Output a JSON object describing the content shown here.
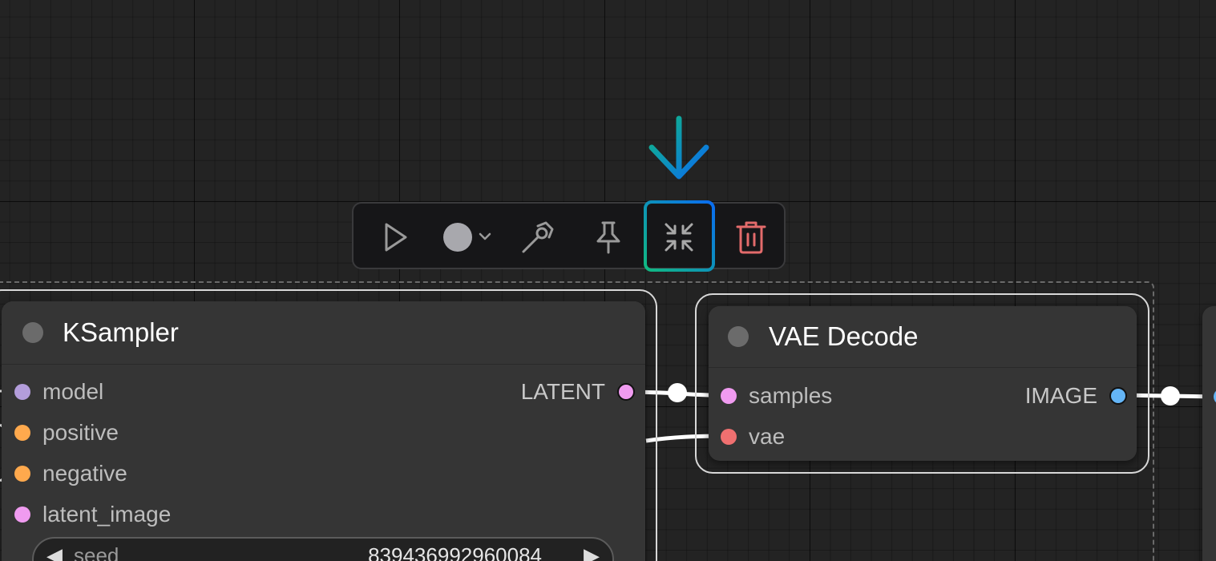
{
  "toolbar": {
    "buttons": [
      {
        "name": "execute",
        "icon": "play-icon"
      },
      {
        "name": "color",
        "icon": "circle-color-icon"
      },
      {
        "name": "bypass",
        "icon": "bypass-icon"
      },
      {
        "name": "pin",
        "icon": "pin-icon"
      },
      {
        "name": "collapse",
        "icon": "collapse-icon"
      },
      {
        "name": "delete",
        "icon": "trash-icon"
      }
    ],
    "highlight_colors": [
      "#10b981",
      "#0a6cf1"
    ]
  },
  "nodes": {
    "ksampler": {
      "title": "KSampler",
      "inputs": [
        {
          "label": "model",
          "color": "#b39ddb"
        },
        {
          "label": "positive",
          "color": "#ffa94d"
        },
        {
          "label": "negative",
          "color": "#ffa94d"
        },
        {
          "label": "latent_image",
          "color": "#f09bf0"
        }
      ],
      "output": {
        "label": "LATENT",
        "color": "#f09bf0"
      },
      "widget": {
        "name": "seed",
        "value": "839436992960084",
        "left_arrow": "◀",
        "right_arrow": "▶"
      }
    },
    "vae_decode": {
      "title": "VAE Decode",
      "inputs": [
        {
          "label": "samples",
          "color": "#f09bf0"
        },
        {
          "label": "vae",
          "color": "#f07070"
        }
      ],
      "output": {
        "label": "IMAGE",
        "color": "#64b5f6"
      }
    }
  }
}
